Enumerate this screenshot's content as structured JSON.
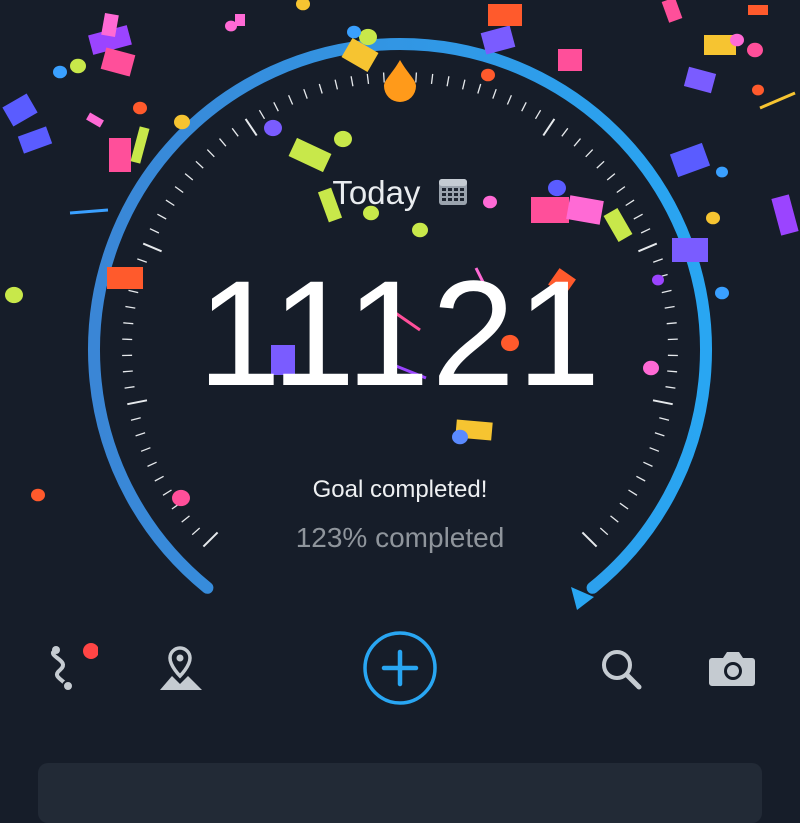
{
  "header": {
    "today_label": "Today",
    "calendar_icon": "calendar-icon"
  },
  "steps": {
    "value": "11121"
  },
  "goal": {
    "status_text": "Goal completed!",
    "percent_text": "123% completed",
    "progress_fraction": 1.23
  },
  "colors": {
    "background": "#161d29",
    "ring_start": "#3a86d6",
    "ring_end": "#29a6f2",
    "accent": "#29a6f2",
    "badge": "#ff4545",
    "tick": "#ffffff"
  },
  "bottom_nav": {
    "items": [
      {
        "icon": "route-icon",
        "has_badge": true
      },
      {
        "icon": "map-pin-icon"
      },
      {
        "icon": "add-icon"
      },
      {
        "icon": "search-icon"
      },
      {
        "icon": "camera-icon"
      }
    ]
  }
}
